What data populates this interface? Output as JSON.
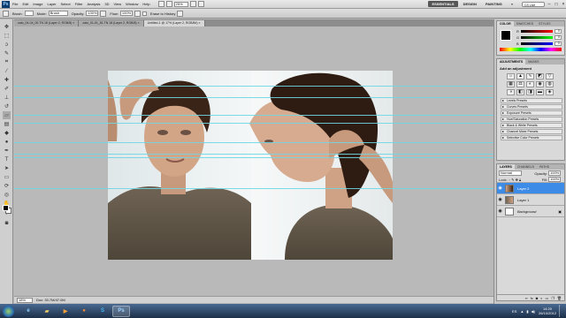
{
  "menubar": {
    "app_logo": "Ps",
    "items": [
      "File",
      "Edit",
      "Image",
      "Layer",
      "Select",
      "Filter",
      "Analysis",
      "3D",
      "View",
      "Window",
      "Help"
    ],
    "zoom_select": "25%",
    "workspaces": [
      "ESSENTIALS",
      "DESIGN",
      "PAINTING"
    ],
    "more_label": "»",
    "cs_live": "CS Live"
  },
  "options": {
    "brush_label": "Brush:",
    "mode_label": "Mode:",
    "mode_value": "Brush",
    "opacity_label": "Opacity:",
    "opacity_value": "100%",
    "flow_label": "Flow:",
    "flow_value": "100%",
    "erase_history": "Erase to History"
  },
  "tabs": [
    "zato_04-04_00.TN 18 (Layer 2, RGB/8) ×",
    "zato_01-01_81.TN 18 (Layer 2, RGB/8) ×",
    "Untitled-1 @ 17% (Layer 2, RGB/8#) ×"
  ],
  "status": {
    "zoom": "18%",
    "doc": "Doc: 33.7M/47.0M"
  },
  "color_panel": {
    "tabs": [
      "COLOR",
      "SWATCHES",
      "STYLES"
    ],
    "channels": [
      {
        "label": "R",
        "value": "0"
      },
      {
        "label": "G",
        "value": "0"
      },
      {
        "label": "B",
        "value": "0"
      }
    ]
  },
  "adjustments": {
    "tabs": [
      "ADJUSTMENTS",
      "MASKS"
    ],
    "title": "Add an adjustment",
    "presets": [
      "Levels Presets",
      "Curves Presets",
      "Exposure Presets",
      "Hue/Saturation Presets",
      "Black & White Presets",
      "Channel Mixer Presets",
      "Selective Color Presets"
    ]
  },
  "layers": {
    "tabs": [
      "LAYERS",
      "CHANNELS",
      "PATHS"
    ],
    "blend": "Normal",
    "opacity_label": "Opacity:",
    "opacity": "100%",
    "lock_label": "Lock:",
    "fill_label": "Fill:",
    "fill": "100%",
    "items": [
      {
        "name": "Layer 2",
        "active": true
      },
      {
        "name": "Layer 1",
        "active": false
      },
      {
        "name": "Background",
        "active": false
      }
    ]
  },
  "taskbar": {
    "apps": [
      "ie",
      "folder",
      "media",
      "firefox",
      "skype",
      "photoshop"
    ],
    "language": "ES",
    "time": "14:20",
    "date": "26/10/2012"
  },
  "colors": {
    "accent": "#3c8be6",
    "guide": "#6fd6e4"
  }
}
